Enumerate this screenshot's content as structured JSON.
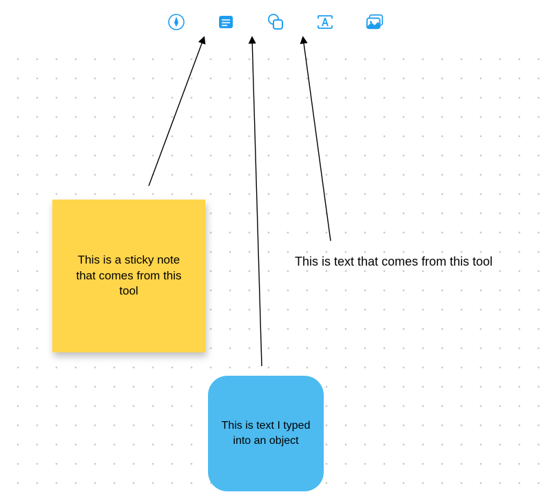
{
  "toolbar": {
    "accent_color": "#1e9df0",
    "tools": {
      "pen": "pen-tool",
      "sticky_note": "sticky-note-tool",
      "shape": "shape-tool",
      "text": "text-tool",
      "media": "media-tool"
    }
  },
  "canvas": {
    "sticky_note_text": "This is a sticky note that comes from this tool",
    "object_text": "This is text I typed into an object",
    "floating_text": "This is text that comes from this tool"
  },
  "colors": {
    "sticky_yellow": "#ffd54a",
    "object_blue": "#4dbbf0",
    "dot": "#c9c9c9"
  }
}
